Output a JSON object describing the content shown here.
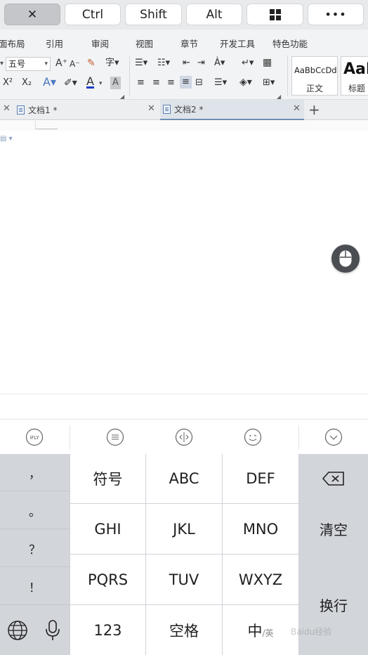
{
  "top_keys": {
    "close": "✕",
    "ctrl": "Ctrl",
    "shift": "Shift",
    "alt": "Alt",
    "windows": "⊞",
    "more": "•••"
  },
  "menu": [
    "面布局",
    "引用",
    "审阅",
    "视图",
    "章节",
    "开发工具",
    "特色功能"
  ],
  "toolbar": {
    "font_size": "五号",
    "increase_font": "A⁺",
    "decrease_font": "A⁻",
    "superscript": "X²",
    "subscript": "X₂",
    "styles": [
      {
        "preview": "AaBbCcDd",
        "name": "正文"
      },
      {
        "preview": "AaB",
        "name": "标题"
      }
    ]
  },
  "tabs": [
    {
      "label": "文档1 *"
    },
    {
      "label": "文档2 *"
    }
  ],
  "new_tab": "+",
  "keyboard": {
    "punctuation": [
      "，",
      "。",
      "？",
      "！"
    ],
    "rows": [
      [
        "符号",
        "ABC",
        "DEF"
      ],
      [
        "GHI",
        "JKL",
        "MNO"
      ],
      [
        "PQRS",
        "TUV",
        "WXYZ"
      ],
      [
        "123",
        "空格",
        "中"
      ]
    ],
    "lang_sub": "/英",
    "clear": "清空",
    "enter": "换行"
  },
  "candidate_icons": [
    "ifly-icon",
    "menu-icon",
    "cursor-move-icon",
    "emoji-icon",
    "collapse-icon"
  ],
  "ifly_text": "iFLY",
  "watermark": "Baidu经验",
  "accent": "#6f8fb5"
}
